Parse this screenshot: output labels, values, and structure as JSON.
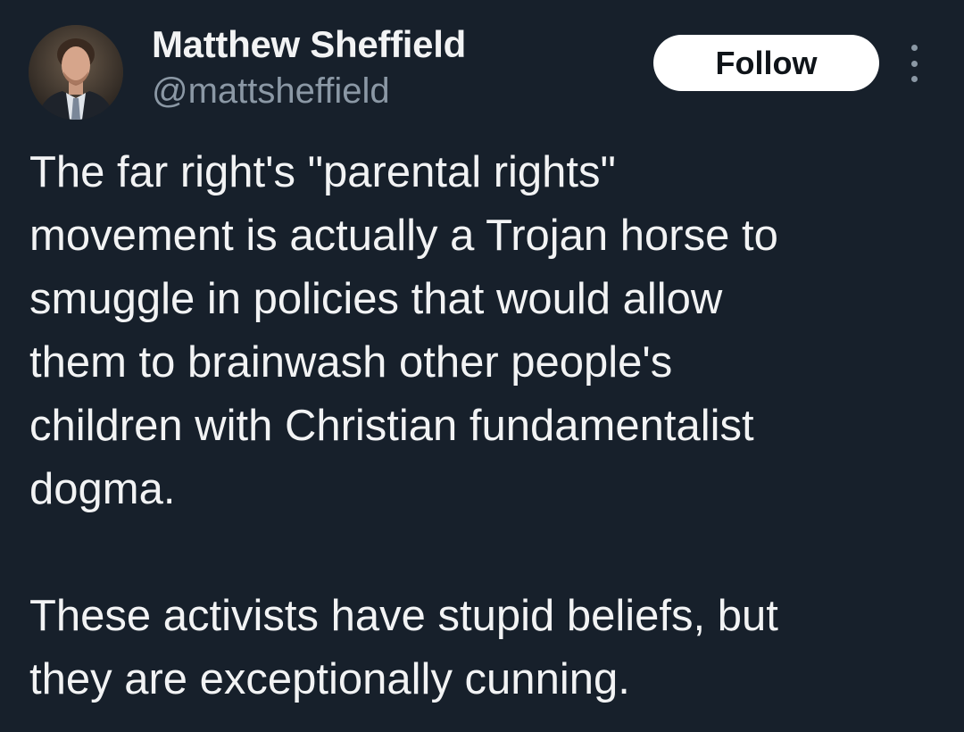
{
  "author": {
    "name": "Matthew Sheffield",
    "handle": "@mattsheffield",
    "avatar_icon": "profile-photo"
  },
  "actions": {
    "follow_label": "Follow",
    "more_icon": "more-vertical-icon"
  },
  "tweet": {
    "paragraph_1": "The far right's \"parental rights\"\nmovement is actually a Trojan horse to\nsmuggle in policies that would allow\nthem to brainwash other people's\nchildren with Christian fundamentalist\ndogma.",
    "paragraph_2": "These activists have stupid beliefs, but\nthey are exceptionally cunning."
  },
  "colors": {
    "background": "#17202b",
    "text": "#f2f3f4",
    "secondary_text": "#8b98a5",
    "button_bg": "#ffffff",
    "button_text": "#0f1419"
  }
}
